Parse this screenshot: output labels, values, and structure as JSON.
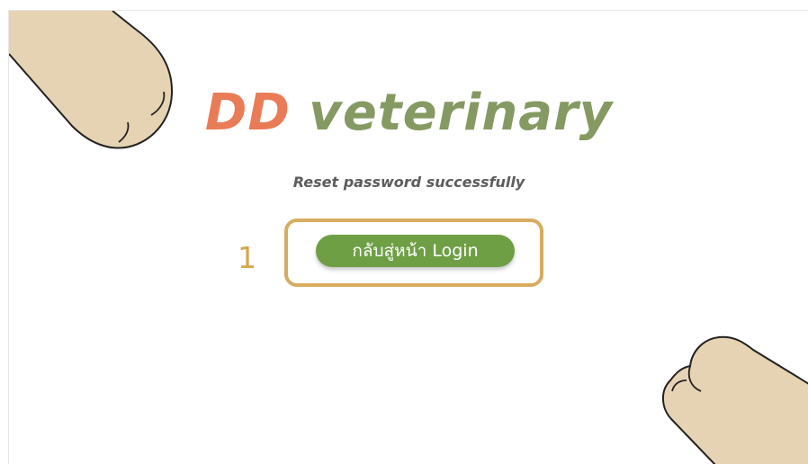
{
  "brand": {
    "accent_text": "D",
    "prefix_text": "D",
    "rest_text": " veterinary"
  },
  "subtitle": "Reset password successfully",
  "step_number": "1",
  "login_button_label": "กลับสู่หน้า Login",
  "colors": {
    "brand_green": "#859a62",
    "brand_accent": "#ea7b57",
    "button_green": "#6f9f45",
    "highlight": "#d7ac60",
    "paw_fill": "#e6d3b3"
  },
  "icons": {
    "top_left": "paw-icon",
    "bottom_right": "paw-icon"
  }
}
